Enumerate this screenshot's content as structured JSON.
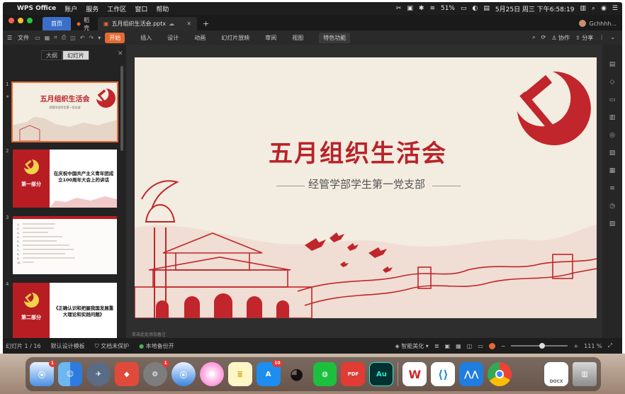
{
  "menubar": {
    "app_name": "WPS Office",
    "items": [
      "账户",
      "服务",
      "工作区",
      "窗口",
      "帮助"
    ],
    "battery": "51%",
    "datetime": "5月25日 周三 下午6:58:19"
  },
  "tabs": {
    "home": "首页",
    "daoke": "稻壳",
    "doc": "五月组织生活会.pptx",
    "user": "Gchhhh..."
  },
  "toolbar": {
    "file": "文件",
    "menus": [
      "开始",
      "插入",
      "设计",
      "动画",
      "幻灯片放映",
      "审阅",
      "视图"
    ],
    "special": "特色功能",
    "collab": "协作",
    "share": "分享"
  },
  "sidebar": {
    "seg_outline": "大纲",
    "seg_slides": "幻灯片",
    "slides": [
      {
        "num": "1",
        "title": "五月组织生活会",
        "subtitle": "经管学部学生第一党支部"
      },
      {
        "num": "2",
        "section": "第一部分",
        "text": "在庆祝中国共产主义青年团成立100周年大会上的讲话"
      },
      {
        "num": "3",
        "lines": [
          "1、",
          "2、",
          "3、",
          "4、",
          "5、",
          "6、",
          "7、",
          "8、",
          "9、",
          "10、"
        ]
      },
      {
        "num": "4",
        "section": "第二部分",
        "text": "《正确认识和把握我国发展重大理论和实践问题》"
      }
    ],
    "add": "+"
  },
  "slide": {
    "title": "五月组织生活会",
    "subtitle": "经管学部学生第一党支部"
  },
  "note_placeholder": "单击此处添加备注",
  "status": {
    "slide_count": "幻灯片 1 / 16",
    "template": "默认设计模板",
    "protect": "文档未保护",
    "backup": "本地备份开",
    "beautify": "智能美化",
    "zoom": "111 %"
  },
  "dock": {
    "badge_finder": "1",
    "badge_settings": "1",
    "badge_appstore": "10",
    "pdf": "PDF",
    "au": "Au",
    "docx": "DOCX"
  },
  "colors": {
    "accent": "#e46a34",
    "party_red": "#b8232a",
    "slide_bg": "#f3ece0"
  }
}
